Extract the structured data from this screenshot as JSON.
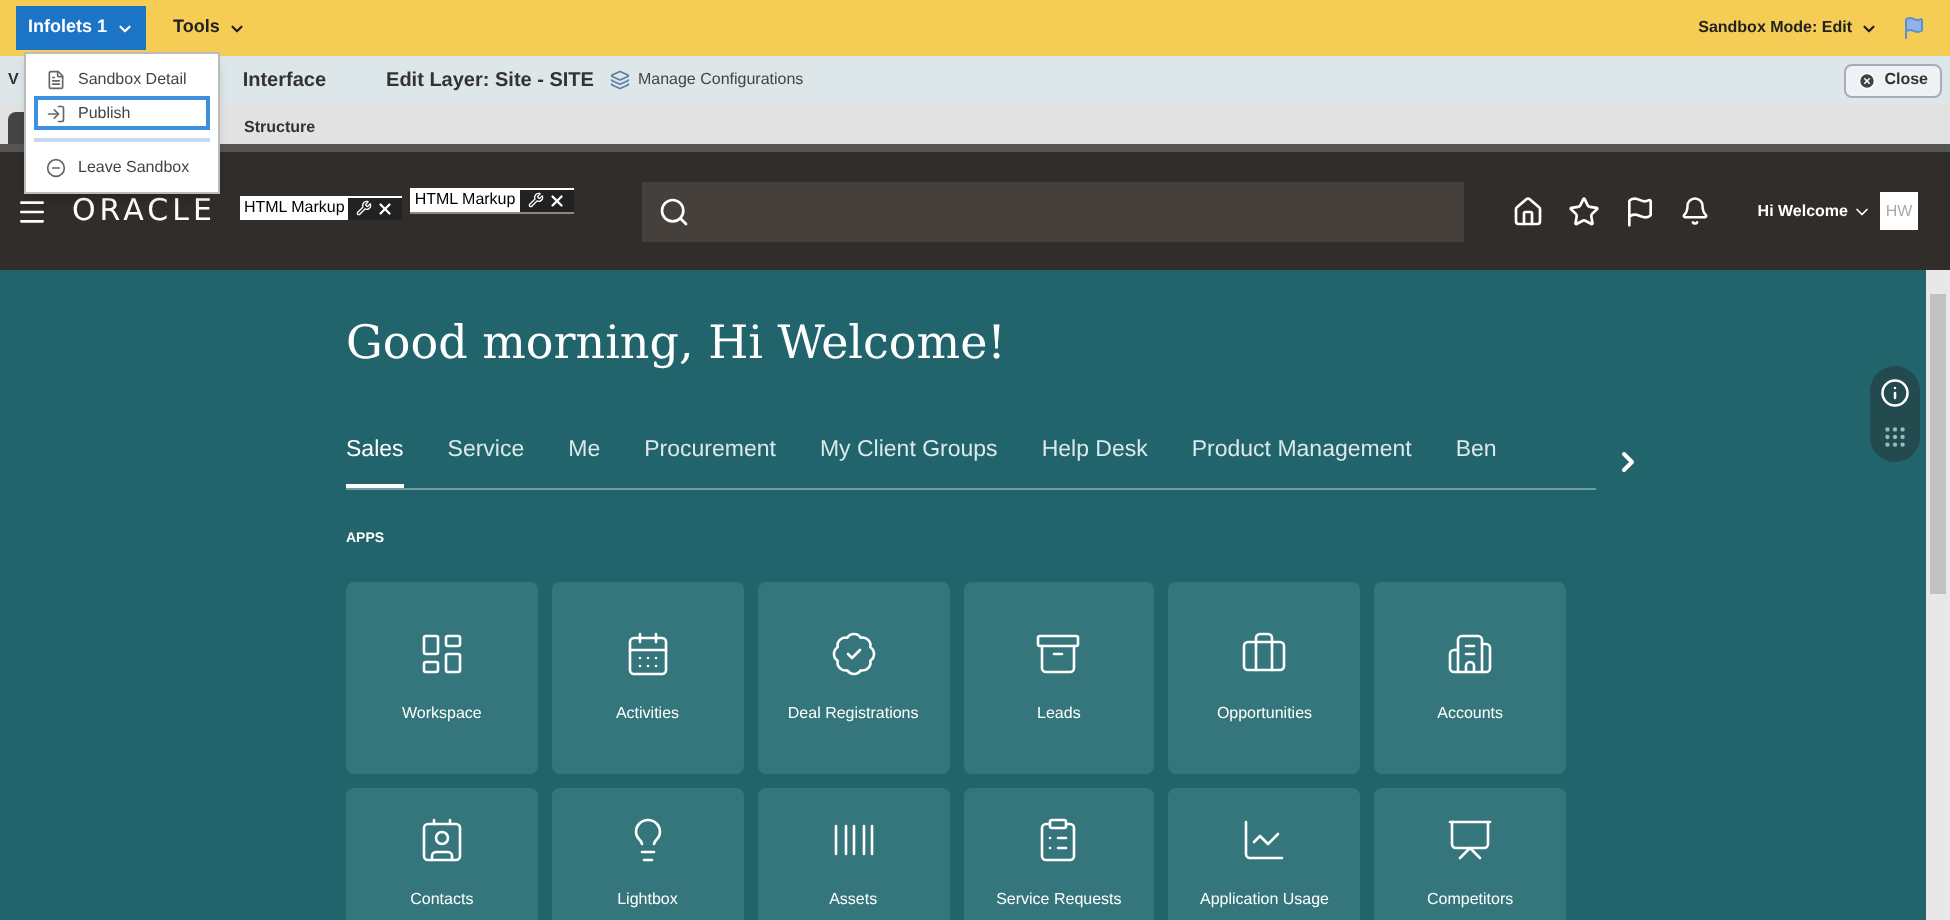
{
  "toolbar": {
    "menus": [
      {
        "label": "Infolets 1",
        "selected": true
      },
      {
        "label": "Tools",
        "selected": false
      }
    ],
    "mode": "Sandbox Mode: Edit"
  },
  "dropdown": {
    "items": [
      {
        "label": "Sandbox Detail",
        "selected": false,
        "kind": "detail"
      },
      {
        "label": "Publish",
        "selected": true,
        "kind": "publish"
      },
      {
        "label": "Leave Sandbox",
        "selected": false,
        "kind": "leave"
      }
    ]
  },
  "edit_bar": {
    "partial_label": "V",
    "title": "Interface",
    "layer": "Edit Layer: Site - SITE",
    "manage": "Manage Configurations",
    "close": "Close"
  },
  "structure_tab": "Structure",
  "header": {
    "logo": "ORACLE",
    "markup_widgets": [
      "HTML Markup",
      "HTML Markup"
    ],
    "user": "Hi Welcome",
    "avatar": "HW"
  },
  "greeting": "Good morning, Hi Welcome!",
  "tabs": [
    {
      "label": "Sales",
      "selected": true
    },
    {
      "label": "Service",
      "selected": false
    },
    {
      "label": "Me",
      "selected": false
    },
    {
      "label": "Procurement",
      "selected": false
    },
    {
      "label": "My Client Groups",
      "selected": false
    },
    {
      "label": "Help Desk",
      "selected": false
    },
    {
      "label": "Product Management",
      "selected": false
    },
    {
      "label": "Ben",
      "selected": false
    }
  ],
  "section": "APPS",
  "apps": [
    "Workspace",
    "Activities",
    "Deal Registrations",
    "Leads",
    "Opportunities",
    "Accounts",
    "Contacts",
    "Lightbox",
    "Assets",
    "Service Requests",
    "Application Usage",
    "Competitors"
  ]
}
